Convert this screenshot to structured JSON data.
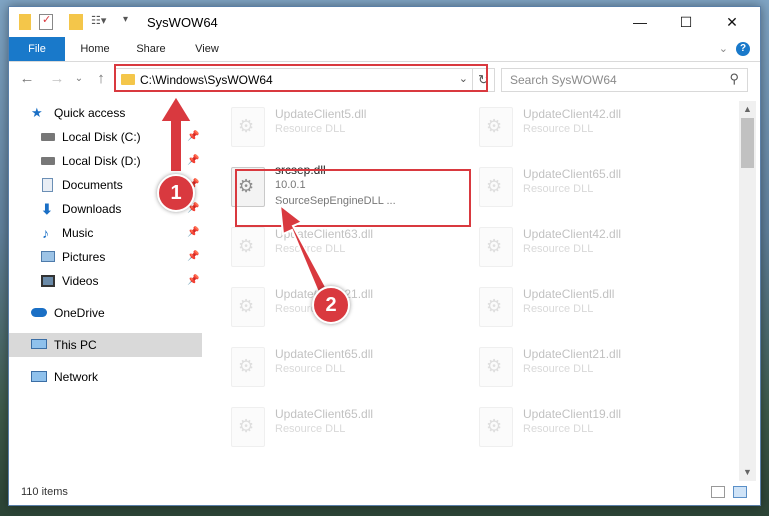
{
  "window": {
    "title": "SysWOW64",
    "controls": {
      "minimize": "—",
      "maximize": "☐",
      "close": "✕"
    }
  },
  "ribbon": {
    "tabs": [
      "File",
      "Home",
      "Share",
      "View"
    ],
    "help_label": "?"
  },
  "navigation": {
    "address": "C:\\Windows\\SysWOW64",
    "search_placeholder": "Search SysWOW64"
  },
  "sidebar": {
    "items": [
      {
        "label": "Quick access",
        "icon": "star-icon"
      },
      {
        "label": "Local Disk (C:)",
        "icon": "drive-icon",
        "pinned": true
      },
      {
        "label": "Local Disk (D:)",
        "icon": "drive-icon",
        "pinned": true
      },
      {
        "label": "Documents",
        "icon": "documents-icon",
        "pinned": true
      },
      {
        "label": "Downloads",
        "icon": "downloads-icon",
        "pinned": true
      },
      {
        "label": "Music",
        "icon": "music-icon",
        "pinned": true
      },
      {
        "label": "Pictures",
        "icon": "pictures-icon",
        "pinned": true
      },
      {
        "label": "Videos",
        "icon": "videos-icon",
        "pinned": true
      },
      {
        "label": "OneDrive",
        "icon": "onedrive-icon"
      },
      {
        "label": "This PC",
        "icon": "computer-icon",
        "selected": true
      },
      {
        "label": "Network",
        "icon": "network-icon"
      }
    ]
  },
  "files": {
    "left": [
      {
        "name": "UpdateClient5.dll",
        "desc": "Resource DLL",
        "faded": true
      },
      {
        "name": "srcsep.dll",
        "desc": "10.0.1",
        "desc2": "SourceSepEngineDLL ...",
        "faded": false
      },
      {
        "name": "UpdateClient63.dll",
        "desc": "Resource DLL",
        "faded": true
      },
      {
        "name": "UpdateClient21.dll",
        "desc": "Resource DLL",
        "faded": true
      },
      {
        "name": "UpdateClient65.dll",
        "desc": "Resource DLL",
        "faded": true
      },
      {
        "name": "UpdateClient65.dll",
        "desc": "Resource DLL",
        "faded": true
      }
    ],
    "right": [
      {
        "name": "UpdateClient42.dll",
        "desc": "Resource DLL",
        "faded": true
      },
      {
        "name": "UpdateClient65.dll",
        "desc": "Resource DLL",
        "faded": true
      },
      {
        "name": "UpdateClient42.dll",
        "desc": "Resource DLL",
        "faded": true
      },
      {
        "name": "UpdateClient5.dll",
        "desc": "Resource DLL",
        "faded": true
      },
      {
        "name": "UpdateClient21.dll",
        "desc": "Resource DLL",
        "faded": true
      },
      {
        "name": "UpdateClient19.dll",
        "desc": "Resource DLL",
        "faded": true
      }
    ]
  },
  "status": {
    "item_count": "110 items"
  },
  "annotations": {
    "step1": "1",
    "step2": "2",
    "color": "#d9393f"
  }
}
